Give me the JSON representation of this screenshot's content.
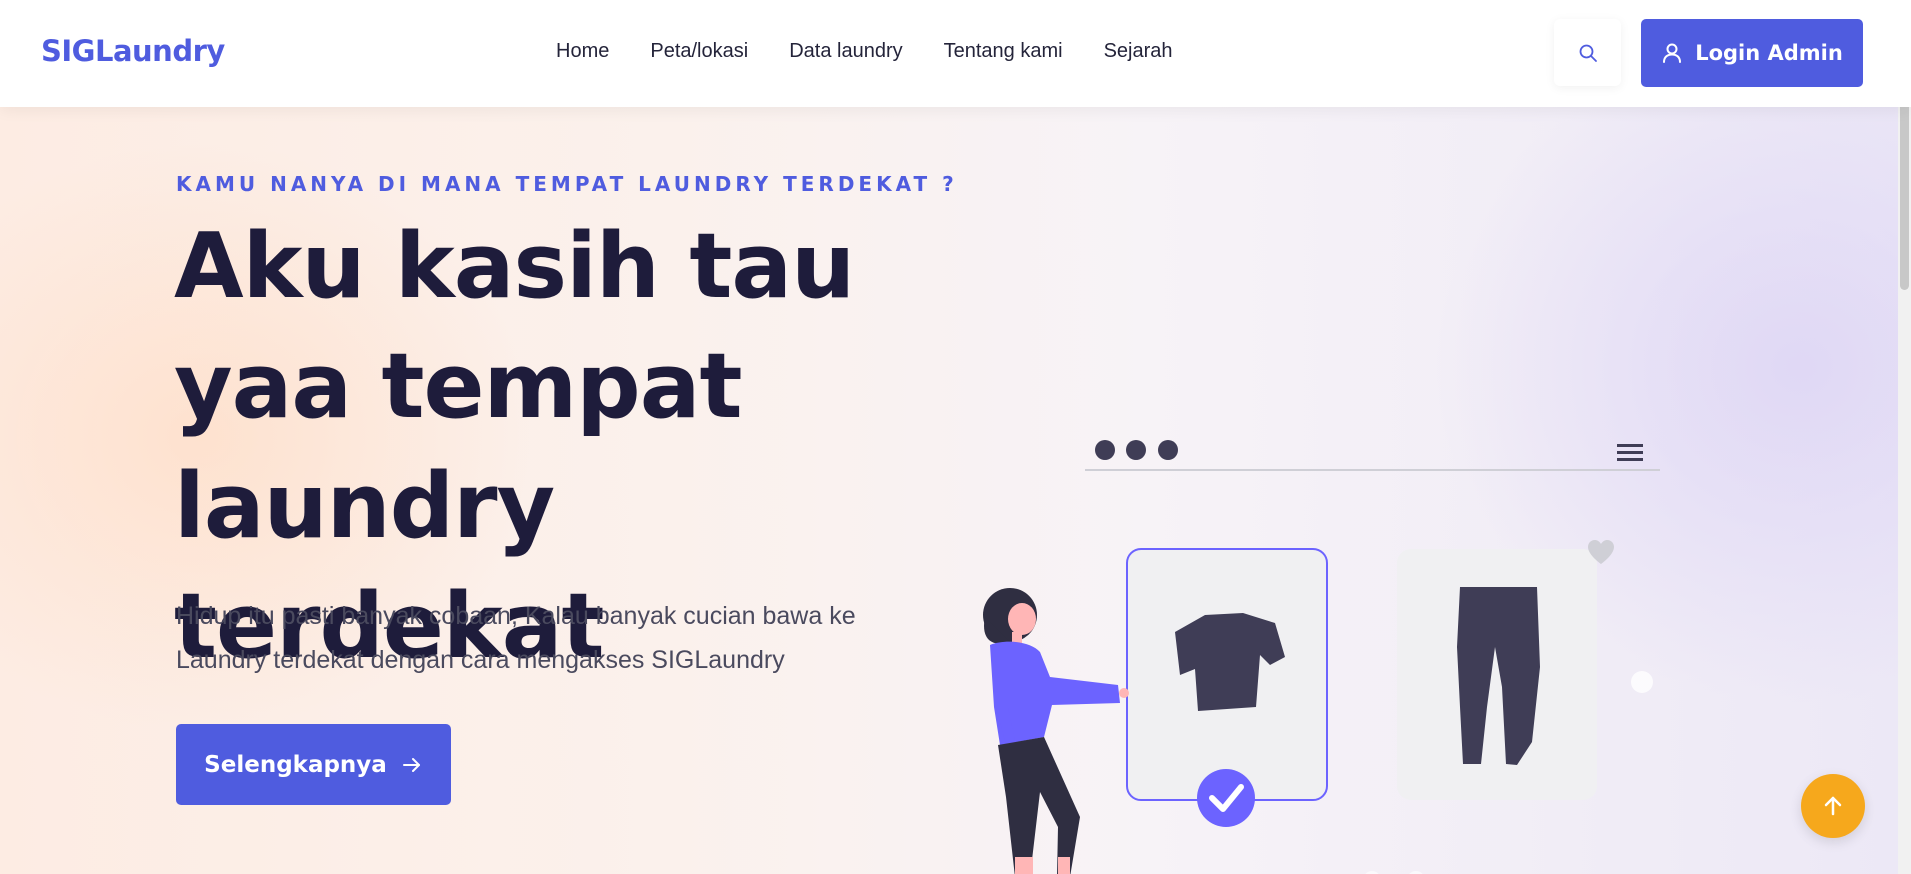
{
  "header": {
    "logo": "SIGLaundry",
    "nav": [
      {
        "label": "Home"
      },
      {
        "label": "Peta/lokasi"
      },
      {
        "label": "Data laundry"
      },
      {
        "label": "Tentang kami"
      },
      {
        "label": "Sejarah"
      }
    ],
    "search_icon": "search-icon",
    "login_label": "Login Admin",
    "login_icon": "user-icon"
  },
  "hero": {
    "eyebrow": "KAMU NANYA DI MANA TEMPAT LAUNDRY TERDEKAT ?",
    "title": "Aku kasih tau yaa tempat laundry terdekat",
    "description": "Hidup itu pasti banyak cobaan, Kalau banyak cucian bawa ke Laundry terdekat dengan cara mengakses SIGLaundry",
    "cta_label": "Selengkapnya",
    "cta_icon": "arrow-right-icon"
  },
  "scroll_top_icon": "arrow-up-icon",
  "colors": {
    "brand": "#4f5cdf",
    "heading": "#1e1c3b",
    "accent_orange": "#f6a81c",
    "illustration_purple": "#6c63ff",
    "illustration_dark": "#3f3d56"
  }
}
